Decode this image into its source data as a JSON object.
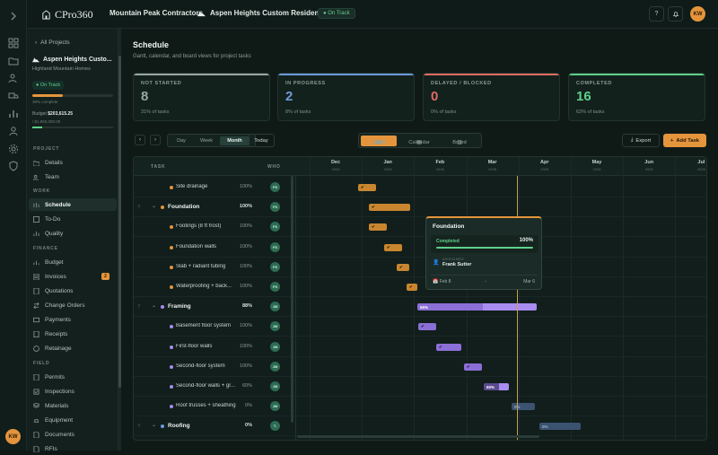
{
  "app": {
    "logo": "CPro360",
    "company": "Mountain Peak Contractors",
    "project": "Aspen Heights Custom Residence",
    "status": "On Track",
    "help": "?",
    "user_initials": "KW"
  },
  "sidebar": {
    "all_projects": "All Projects",
    "project_name": "Aspen Heights Custo...",
    "project_sub": "Highland Mountain Homes",
    "status": "On Track",
    "complete_text": "38% complete",
    "progress": 0.38,
    "budget_label": "Budget",
    "budget_spent": "$203,615.25",
    "budget_total": "/ $1,850,000.00",
    "sections": {
      "project": "PROJECT",
      "work": "WORK",
      "finance": "FINANCE",
      "field": "FIELD"
    },
    "items": {
      "details": "Details",
      "team": "Team",
      "schedule": "Schedule",
      "todo": "To-Do",
      "quality": "Quality",
      "budget": "Budget",
      "invoices": "Invoices",
      "invoices_badge": "2",
      "quotations": "Quotations",
      "change_orders": "Change Orders",
      "payments": "Payments",
      "receipts": "Receipts",
      "retainage": "Retainage",
      "permits": "Permits",
      "inspections": "Inspections",
      "materials": "Materials",
      "equipment": "Equipment",
      "documents": "Documents",
      "rfis": "RFIs"
    }
  },
  "page": {
    "title": "Schedule",
    "subtitle": "Gantt, calendar, and board views for project tasks"
  },
  "stats": [
    {
      "label": "NOT STARTED",
      "value": "8",
      "sub": "31% of tasks",
      "color": "#9aa6a2"
    },
    {
      "label": "IN PROGRESS",
      "value": "2",
      "sub": "8% of tasks",
      "color": "#6f9bdb"
    },
    {
      "label": "DELAYED / BLOCKED",
      "value": "0",
      "sub": "0% of tasks",
      "color": "#e06b5f"
    },
    {
      "label": "COMPLETED",
      "value": "16",
      "sub": "62% of tasks",
      "color": "#5fd08a"
    }
  ],
  "controls": {
    "prev": "‹",
    "next": "›",
    "day": "Day",
    "week": "Week",
    "month": "Month",
    "today": "Today",
    "gantt": "Gantt",
    "calendar": "Calendar",
    "board": "Board",
    "export": "Export",
    "add_task": "Add Task"
  },
  "gantt": {
    "col_task": "TASK",
    "col_who": "WHO",
    "months": [
      {
        "m": "Dec",
        "y": "2025"
      },
      {
        "m": "Jan",
        "y": "2026"
      },
      {
        "m": "Feb",
        "y": "2026"
      },
      {
        "m": "Mar",
        "y": "2026"
      },
      {
        "m": "Apr",
        "y": "2026"
      },
      {
        "m": "May",
        "y": "2026"
      },
      {
        "m": "Jun",
        "y": "2026"
      },
      {
        "m": "Jul",
        "y": "2026"
      }
    ],
    "rows": [
      {
        "name": "Site drainage",
        "pct": "100%",
        "who": "FS",
        "parent": false
      },
      {
        "name": "Foundation",
        "pct": "100%",
        "who": "FS",
        "parent": true
      },
      {
        "name": "Footings (8 ft frost)",
        "pct": "100%",
        "who": "FS",
        "parent": false
      },
      {
        "name": "Foundation walls",
        "pct": "100%",
        "who": "FS",
        "parent": false
      },
      {
        "name": "Slab + radiant tubing",
        "pct": "100%",
        "who": "FS",
        "parent": false
      },
      {
        "name": "Waterproofing + back...",
        "pct": "100%",
        "who": "FS",
        "parent": false
      },
      {
        "name": "Framing",
        "pct": "88%",
        "who": "JM",
        "parent": true
      },
      {
        "name": "Basement floor system",
        "pct": "100%",
        "who": "JM",
        "parent": false
      },
      {
        "name": "First-floor walls",
        "pct": "100%",
        "who": "JM",
        "parent": false
      },
      {
        "name": "Second-floor system",
        "pct": "100%",
        "who": "JM",
        "parent": false
      },
      {
        "name": "Second-floor walls + gr...",
        "pct": "60%",
        "who": "JM",
        "parent": false
      },
      {
        "name": "Roof trusses + sheathing",
        "pct": "0%",
        "who": "JM",
        "parent": false
      },
      {
        "name": "Roofing",
        "pct": "0%",
        "who": "T-",
        "parent": true
      }
    ],
    "bar_labels": {
      "check": "✔",
      "framing": "55%",
      "walls": "60%",
      "trusses": "0%",
      "roofing": "0%"
    },
    "tooltip": {
      "title": "Foundation",
      "status": "Completed",
      "pct": "100%",
      "assignee_label": "ASSIGNEE",
      "assignee": "Frank Sutter",
      "start": "Feb 8",
      "arrow": "→",
      "end": "Mar 6"
    }
  }
}
